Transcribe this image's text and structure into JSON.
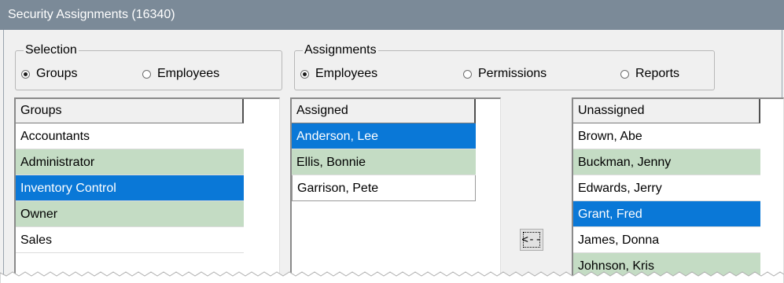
{
  "window": {
    "title": "Security Assignments (16340)"
  },
  "selection": {
    "legend": "Selection",
    "options": [
      {
        "label": "Groups",
        "selected": true
      },
      {
        "label": "Employees",
        "selected": false
      }
    ]
  },
  "assignments": {
    "legend": "Assignments",
    "options": [
      {
        "label": "Employees",
        "selected": true
      },
      {
        "label": "Permissions",
        "selected": false
      },
      {
        "label": "Reports",
        "selected": false
      }
    ]
  },
  "groups_list": {
    "header": "Groups",
    "rows": [
      "Accountants",
      "Administrator",
      "Inventory Control",
      "Owner",
      "Sales"
    ],
    "selected": "Inventory Control"
  },
  "assigned_list": {
    "header": "Assigned",
    "rows": [
      "Anderson, Lee",
      "Ellis, Bonnie",
      "Garrison, Pete"
    ],
    "selected": "Anderson, Lee"
  },
  "unassigned_list": {
    "header": "Unassigned",
    "rows": [
      "Brown, Abe",
      "Buckman, Jenny",
      "Edwards, Jerry",
      "Grant, Fred",
      "James, Donna",
      "Johnson, Kris"
    ],
    "selected": "Grant, Fred"
  },
  "buttons": {
    "move_left": "<--"
  },
  "colors": {
    "titlebar": "#7b8a98",
    "selected_row": "#0a78d7",
    "alt_row": "#c4dcc4"
  }
}
